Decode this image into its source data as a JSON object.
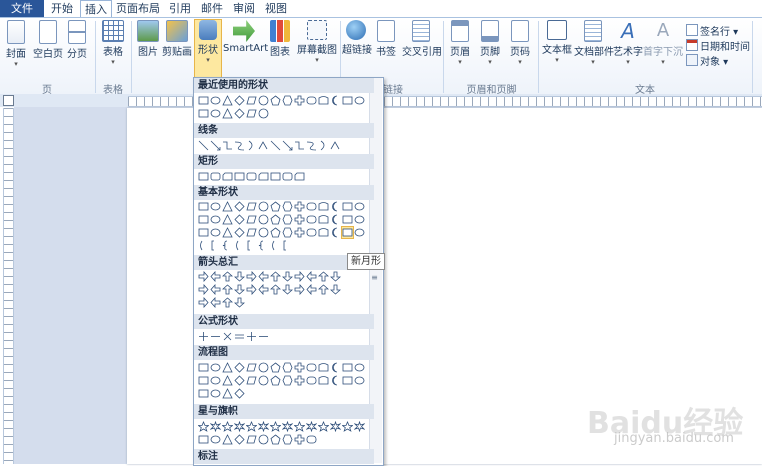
{
  "tabs": {
    "file": "文件",
    "items": [
      "开始",
      "插入",
      "页面布局",
      "引用",
      "邮件",
      "审阅",
      "视图"
    ],
    "active": "插入"
  },
  "ribbon": {
    "page_group": {
      "label": "页",
      "buttons": [
        "封面",
        "空白页",
        "分页"
      ]
    },
    "table_group": {
      "label": "表格",
      "buttons": [
        "表格"
      ]
    },
    "illustrations": {
      "buttons": [
        "图片",
        "剪贴画",
        "形状",
        "SmartArt",
        "图表",
        "屏幕截图"
      ]
    },
    "links": {
      "label": "链接",
      "buttons": [
        "超链接",
        "书签",
        "交叉引用"
      ]
    },
    "header_footer": {
      "label": "页眉和页脚",
      "buttons": [
        "页眉",
        "页脚",
        "页码"
      ]
    },
    "text": {
      "label": "文本",
      "buttons": [
        "文本框",
        "文档部件",
        "艺术字",
        "首字下沉"
      ],
      "small": [
        "签名行",
        "日期和时间",
        "对象"
      ]
    }
  },
  "shapes_panel": {
    "sections": [
      "最近使用的形状",
      "线条",
      "矩形",
      "基本形状",
      "箭头总汇",
      "公式形状",
      "流程图",
      "星与旗帜",
      "标注"
    ],
    "tooltip": "新月形"
  },
  "watermark": {
    "brand": "Baidu经验",
    "url": "jingyan.baidu.com"
  },
  "colors": {
    "file_tab": "#2a5699",
    "section_header": "#dde4ee",
    "shape_stroke": "#2f4f7a",
    "workspace": "#d4dded"
  }
}
